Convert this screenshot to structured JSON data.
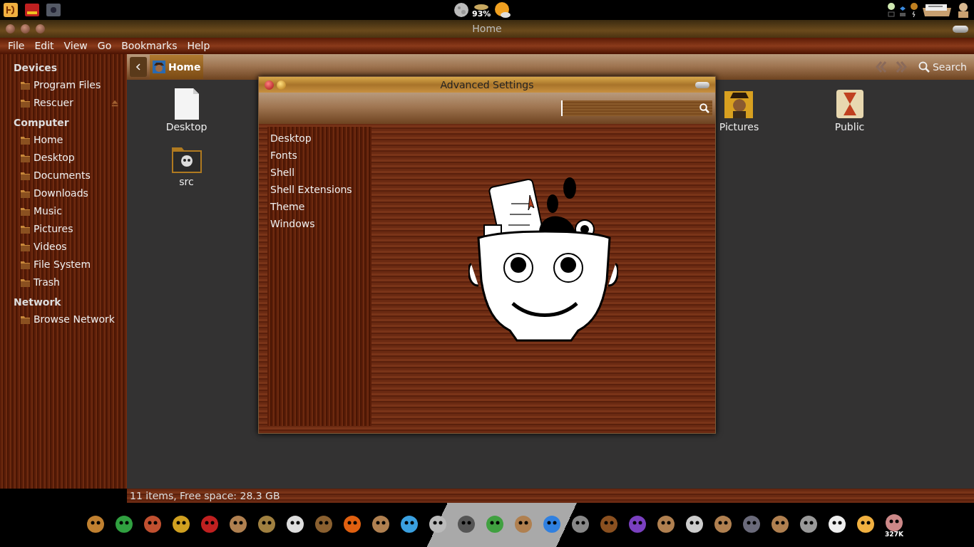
{
  "top_panel": {
    "weather_reading": "93%"
  },
  "window": {
    "title": "Home"
  },
  "menu": [
    "File",
    "Edit",
    "View",
    "Go",
    "Bookmarks",
    "Help"
  ],
  "toolbar": {
    "breadcrumb": "Home",
    "search": "Search"
  },
  "sidebar": {
    "sections": [
      {
        "title": "Devices",
        "items": [
          {
            "label": "Program Files",
            "eject": false
          },
          {
            "label": "Rescuer",
            "eject": true
          }
        ]
      },
      {
        "title": "Computer",
        "items": [
          {
            "label": "Home",
            "eject": false
          },
          {
            "label": "Desktop",
            "eject": false
          },
          {
            "label": "Documents",
            "eject": false
          },
          {
            "label": "Downloads",
            "eject": false
          },
          {
            "label": "Music",
            "eject": false
          },
          {
            "label": "Pictures",
            "eject": false
          },
          {
            "label": "Videos",
            "eject": false
          },
          {
            "label": "File System",
            "eject": false
          },
          {
            "label": "Trash",
            "eject": false
          }
        ]
      },
      {
        "title": "Network",
        "items": [
          {
            "label": "Browse Network",
            "eject": false
          }
        ]
      }
    ]
  },
  "files": [
    {
      "name": "Desktop",
      "kind": "document"
    },
    {
      "name": "Pictures",
      "kind": "pictures"
    },
    {
      "name": "Public",
      "kind": "public"
    },
    {
      "name": "src",
      "kind": "folder"
    }
  ],
  "status_bar": "11 items, Free space: 28.3 GB",
  "dialog": {
    "title": "Advanced Settings",
    "categories": [
      "Desktop",
      "Fonts",
      "Shell",
      "Shell Extensions",
      "Theme",
      "Windows"
    ]
  },
  "dock": {
    "badge": "327K"
  }
}
